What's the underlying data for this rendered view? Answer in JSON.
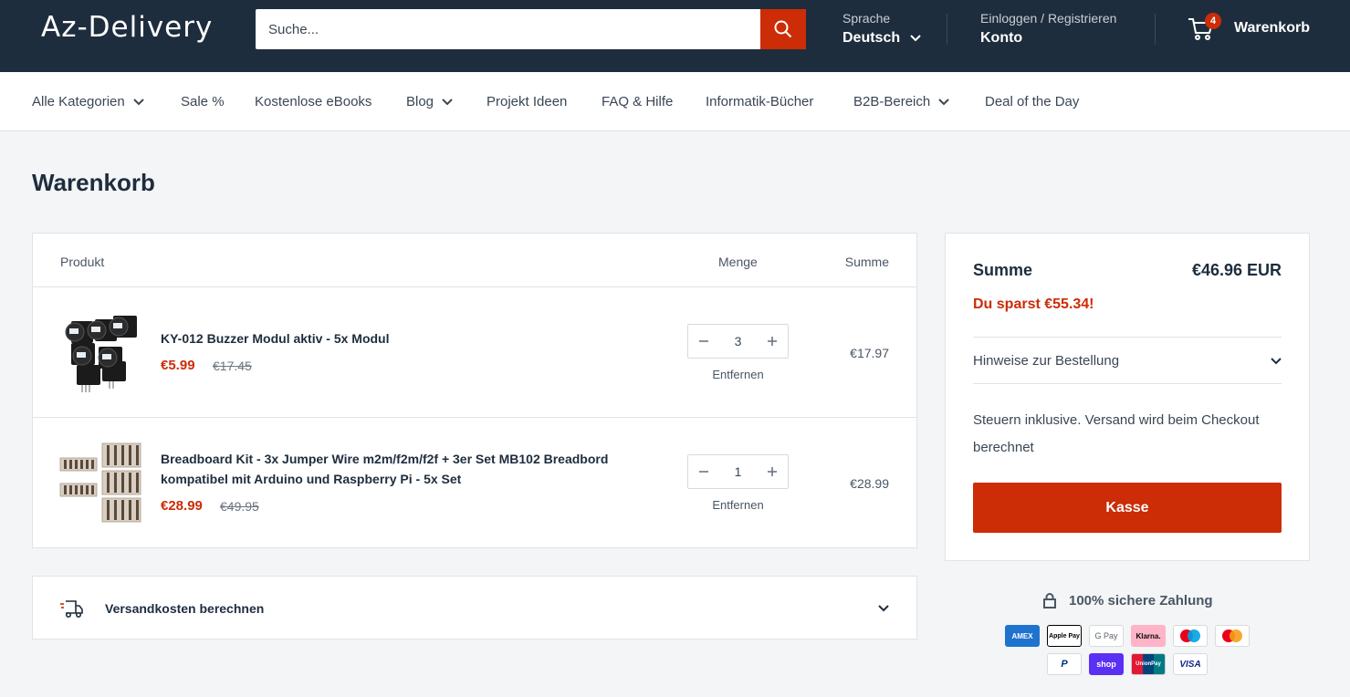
{
  "header": {
    "logo": "Az-Delivery",
    "search_placeholder": "Suche...",
    "language_label": "Sprache",
    "language_value": "Deutsch",
    "account_label": "Einloggen / Registrieren",
    "account_value": "Konto",
    "cart_count": "4",
    "cart_label": "Warenkorb"
  },
  "nav": {
    "items": [
      {
        "label": "Alle Kategorien",
        "dropdown": true
      },
      {
        "label": "Sale %",
        "dropdown": false
      },
      {
        "label": "Kostenlose eBooks",
        "dropdown": false
      },
      {
        "label": "Blog",
        "dropdown": true
      },
      {
        "label": "Projekt Ideen",
        "dropdown": false
      },
      {
        "label": "FAQ & Hilfe",
        "dropdown": false
      },
      {
        "label": "Informatik-Bücher",
        "dropdown": false
      },
      {
        "label": "B2B-Bereich",
        "dropdown": true
      },
      {
        "label": "Deal of the Day",
        "dropdown": false
      }
    ]
  },
  "page": {
    "title": "Warenkorb"
  },
  "cart": {
    "columns": {
      "product": "Produkt",
      "quantity": "Menge",
      "total": "Summe"
    },
    "items": [
      {
        "title": "KY-012 Buzzer Modul aktiv - 5x Modul",
        "price": "€5.99",
        "old_price": "€17.45",
        "quantity": "3",
        "remove": "Entfernen",
        "total": "€17.97"
      },
      {
        "title": "Breadboard Kit - 3x Jumper Wire m2m/f2m/f2f + 3er Set MB102 Breadbord kompatibel mit Arduino und Raspberry Pi - 5x Set",
        "price": "€28.99",
        "old_price": "€49.95",
        "quantity": "1",
        "remove": "Entfernen",
        "total": "€28.99"
      }
    ],
    "shipping_label": "Versandkosten berechnen"
  },
  "summary": {
    "total_label": "Summe",
    "total_value": "€46.96 EUR",
    "savings": "Du sparst €55.34!",
    "notes_label": "Hinweise zur Bestellung",
    "tax_note": "Steuern inklusive. Versand wird beim Checkout berechnet",
    "checkout_label": "Kasse"
  },
  "payment": {
    "secure_label": "100% sichere Zahlung",
    "methods": [
      {
        "name": "AMEX",
        "bg": "#1f72cd",
        "fg": "#ffffff"
      },
      {
        "name": "Apple Pay",
        "bg": "#ffffff",
        "fg": "#000000"
      },
      {
        "name": "G Pay",
        "bg": "#ffffff",
        "fg": "#5f6368"
      },
      {
        "name": "Klarna.",
        "bg": "#ffb3c7",
        "fg": "#0a0b09"
      },
      {
        "name": "Maestro",
        "bg": "#ffffff",
        "fg": "#000000"
      },
      {
        "name": "Mastercard",
        "bg": "#ffffff",
        "fg": "#000000"
      },
      {
        "name": "PayPal",
        "bg": "#ffffff",
        "fg": "#003087"
      },
      {
        "name": "shop",
        "bg": "#5a31f4",
        "fg": "#ffffff"
      },
      {
        "name": "UnionPay",
        "bg": "#e21836",
        "fg": "#ffffff"
      },
      {
        "name": "VISA",
        "bg": "#ffffff",
        "fg": "#142688"
      }
    ]
  },
  "colors": {
    "header_bg": "#1e2d3d",
    "accent": "#cc2c06",
    "page_bg": "#f3f5f6"
  }
}
